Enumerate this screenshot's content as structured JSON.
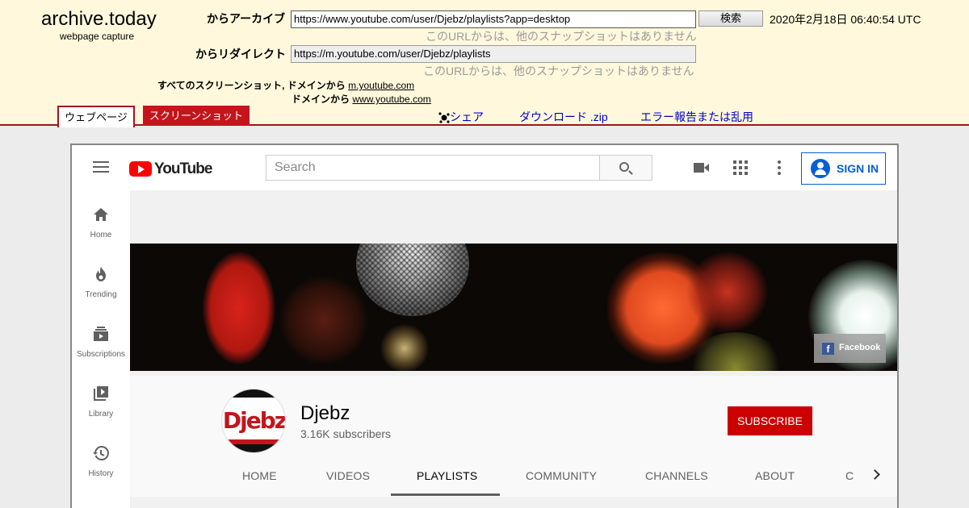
{
  "archive": {
    "logo": "archive.today",
    "logo_sub": "webpage capture",
    "from_archive_label": "からアーカイブ",
    "archive_url": "https://www.youtube.com/user/Djebz/playlists?app=desktop",
    "search_button": "検索",
    "capture_date": "2020年2月18日 06:40:54 UTC",
    "no_other_snapshots_1": "このURLからは、他のスナップショットはありません",
    "redirect_label": "からリダイレクト",
    "redirect_url": "https://m.youtube.com/user/Djebz/playlists",
    "no_other_snapshots_2": "このURLからは、他のスナップショットはありません",
    "all_screenshots_prefix": "すべてのスクリーンショット,",
    "domain_from_1": "ドメインから",
    "domain_link_1": "m.youtube.com",
    "domain_from_2": "ドメインから",
    "domain_link_2": "www.youtube.com",
    "tab_webpage": "ウェブページ",
    "tab_screenshot": "スクリーンショット",
    "share_label": "シェア",
    "download_label": "ダウンロード .zip",
    "report_label": "エラー報告または乱用"
  },
  "youtube": {
    "logo_text": "YouTube",
    "search_placeholder": "Search",
    "signin_label": "SIGN IN",
    "sidebar": [
      {
        "label": "Home",
        "icon": "home-icon"
      },
      {
        "label": "Trending",
        "icon": "flame-icon"
      },
      {
        "label": "Subscriptions",
        "icon": "subscriptions-icon"
      },
      {
        "label": "Library",
        "icon": "library-icon"
      },
      {
        "label": "History",
        "icon": "history-icon"
      }
    ],
    "banner_link": "Facebook",
    "channel": {
      "avatar_text": "Djebz",
      "name": "Djebz",
      "subscribers": "3.16K subscribers",
      "subscribe_label": "SUBSCRIBE",
      "tabs": [
        "HOME",
        "VIDEOS",
        "PLAYLISTS",
        "COMMUNITY",
        "CHANNELS",
        "ABOUT",
        "C"
      ],
      "active_tab": "PLAYLISTS"
    },
    "colors": {
      "accent_red": "#cc0000",
      "signin_blue": "#065fd4",
      "archive_red": "#a5121e"
    }
  }
}
